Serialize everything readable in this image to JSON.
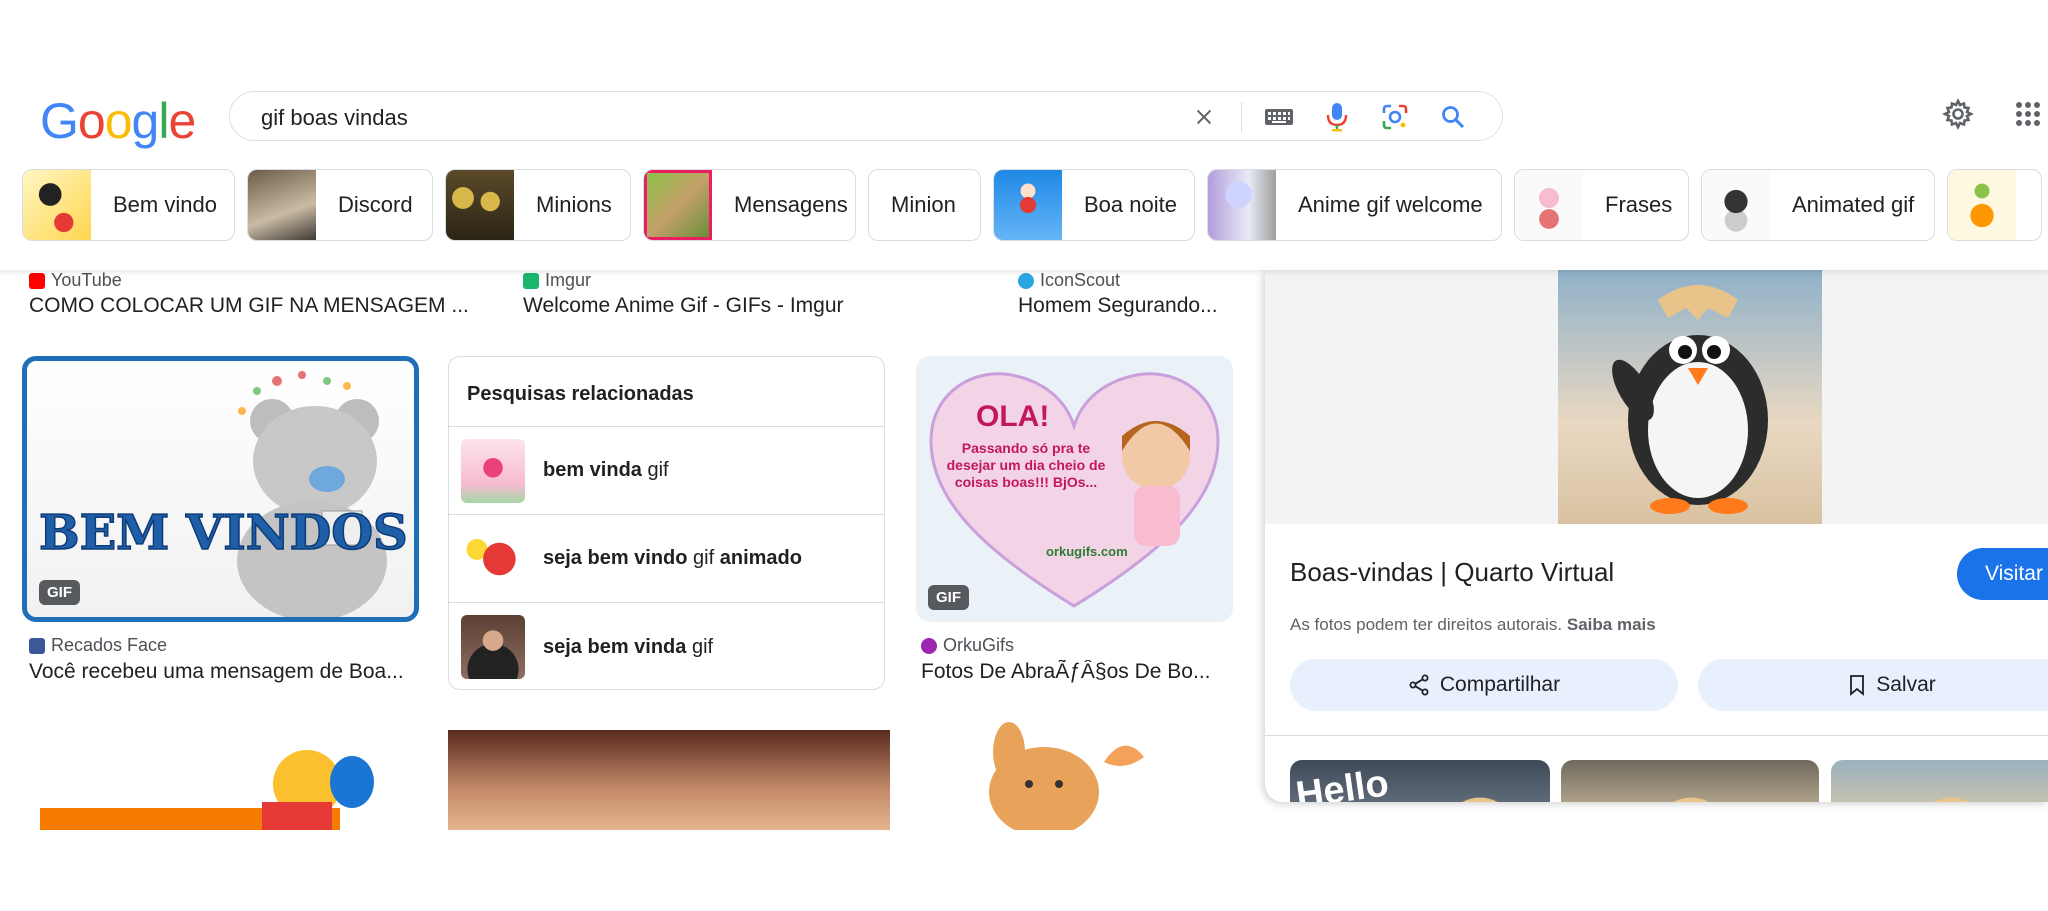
{
  "search": {
    "query": "gif boas vindas"
  },
  "logo": {
    "letters": [
      "G",
      "o",
      "o",
      "g",
      "l",
      "e"
    ],
    "colors": [
      "#4285F4",
      "#EA4335",
      "#FBBC05",
      "#4285F4",
      "#34A853",
      "#EA4335"
    ]
  },
  "chips": [
    {
      "label": "Bem vindo"
    },
    {
      "label": "Discord"
    },
    {
      "label": "Minions"
    },
    {
      "label": "Mensagens"
    },
    {
      "label": "Minion"
    },
    {
      "label": "Boa noite"
    },
    {
      "label": "Anime gif welcome"
    },
    {
      "label": "Frases"
    },
    {
      "label": "Animated gif"
    }
  ],
  "top_results": [
    {
      "source": "YouTube",
      "title": "COMO COLOCAR UM GIF NA MENSAGEM ...",
      "icon_color": "#ff0000"
    },
    {
      "source": "Imgur",
      "title": "Welcome Anime Gif - GIFs - Imgur",
      "icon_color": "#1bb76e"
    },
    {
      "source": "IconScout",
      "title": "Homem Segurando...",
      "icon_color": "#2aa6e0"
    }
  ],
  "image_text": {
    "bem_vindos": "BEM VINDOS",
    "ola_title": "OLA!",
    "ola_message": "Passando só pra te desejar um dia cheio de coisas boas!!! BjOs...",
    "ola_site": "orkugifs.com",
    "hello": "Hello"
  },
  "mid_results": [
    {
      "source": "Recados Face",
      "title": "Você recebeu uma mensagem de Boa...",
      "badge": "GIF"
    },
    {
      "source": "OrkuGifs",
      "title": "Fotos De AbraÃƒÂ§os De Bo...",
      "badge": "GIF"
    }
  ],
  "related": {
    "title": "Pesquisas relacionadas",
    "items": [
      {
        "bold": "bem vinda",
        "rest": " gif",
        "bold2": ""
      },
      {
        "bold": "seja bem vindo",
        "rest": " gif ",
        "bold2": "animado"
      },
      {
        "bold": "seja bem vinda",
        "rest": " gif",
        "bold2": ""
      }
    ]
  },
  "panel": {
    "title": "Boas-vindas | Quarto Virtual",
    "visit_label": "Visitar",
    "copyright_text": "As fotos podem ter direitos autorais.",
    "learn_more": "Saiba mais",
    "share_label": "Compartilhar",
    "save_label": "Salvar"
  }
}
